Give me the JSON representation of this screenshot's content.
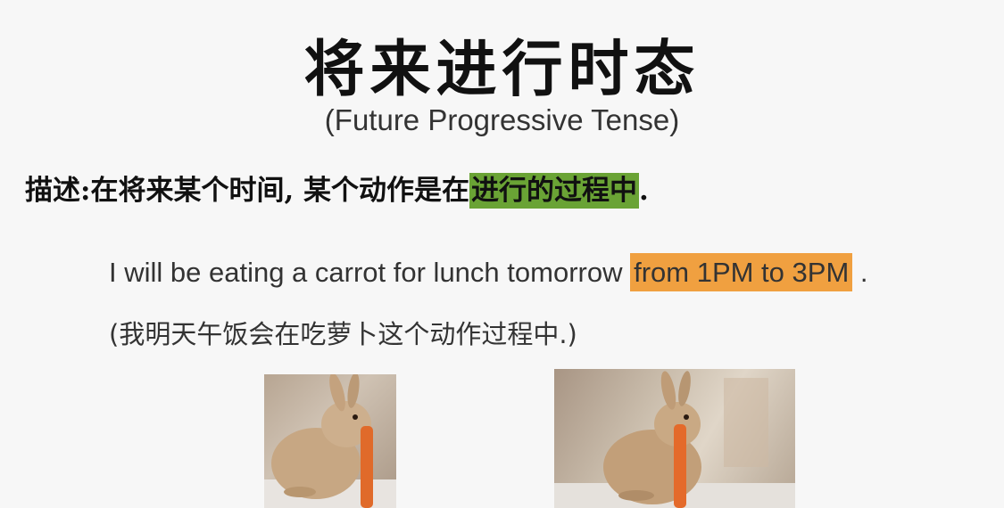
{
  "title": "将来进行时态",
  "subtitle": "(Future Progressive Tense)",
  "description": {
    "prefix": "描述:在将来某个时间, 某个动作是在",
    "highlight": "进行的过程中",
    "suffix": "."
  },
  "example": {
    "prefix": "I will be eating a carrot for lunch tomorrow ",
    "highlight": "from 1PM to 3PM",
    "suffix": " ."
  },
  "translation": "(我明天午饭会在吃萝卜这个动作过程中.)",
  "colors": {
    "green_highlight": "#6aa335",
    "orange_highlight": "#f0a040"
  }
}
